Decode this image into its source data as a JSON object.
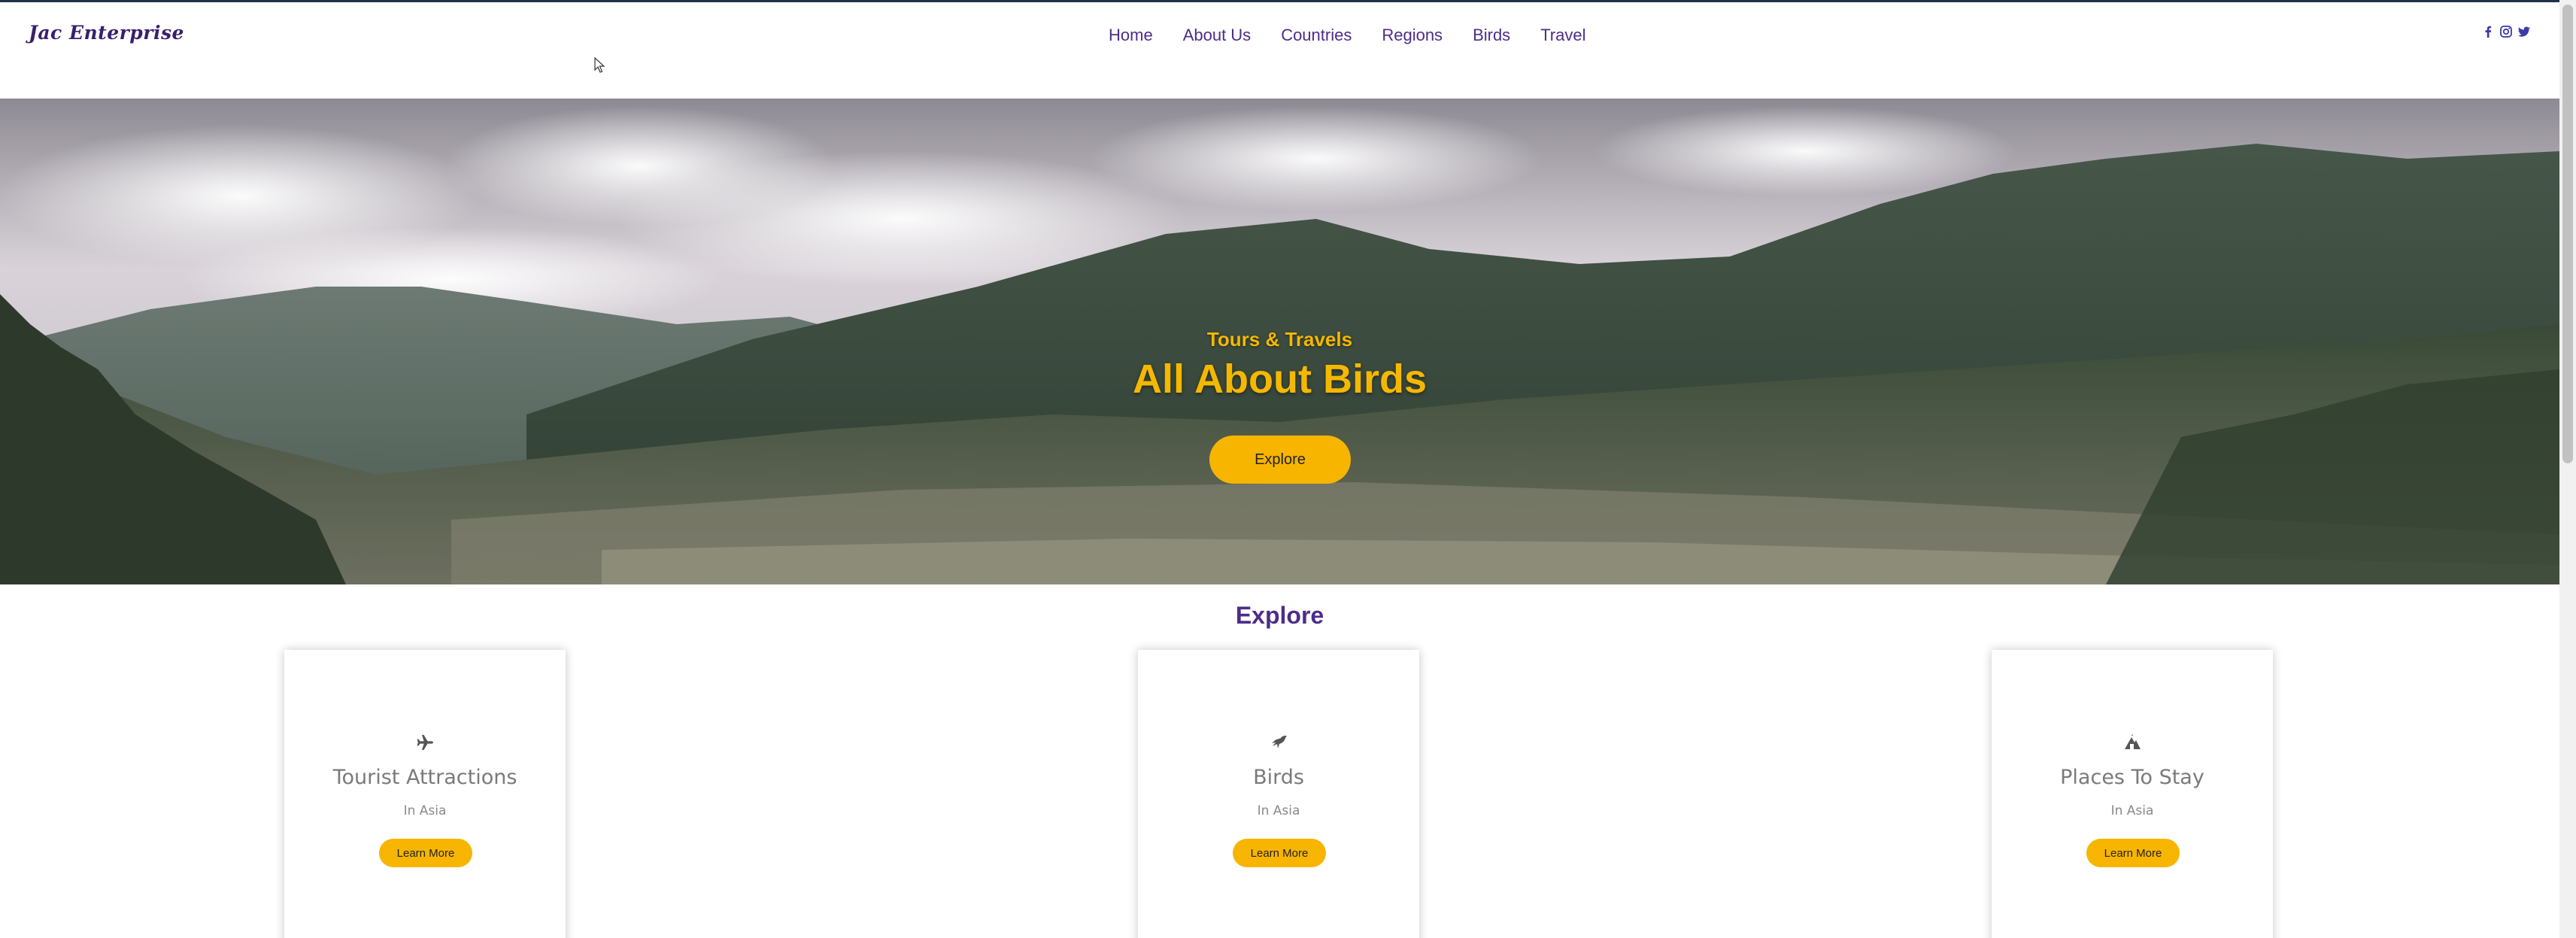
{
  "brand": "Jac Enterprise",
  "nav": {
    "links": [
      "Home",
      "About Us",
      "Countries",
      "Regions",
      "Birds",
      "Travel"
    ]
  },
  "social": [
    "facebook-icon",
    "instagram-icon",
    "twitter-icon"
  ],
  "colors": {
    "brand_purple": "#3a1f6b",
    "nav_purple": "#4d2c8a",
    "accent_yellow": "#f7b500",
    "card_text": "#7a7a7a"
  },
  "hero": {
    "subtitle": "Tours & Travels",
    "title": "All About Birds",
    "button": "Explore"
  },
  "explore": {
    "heading": "Explore",
    "cards": [
      {
        "icon": "plane-icon",
        "title": "Tourist Attractions",
        "subtitle": "In Asia",
        "button": "Learn More"
      },
      {
        "icon": "bird-icon",
        "title": "Birds",
        "subtitle": "In Asia",
        "button": "Learn More"
      },
      {
        "icon": "hotel-icon",
        "title": "Places To Stay",
        "subtitle": "In Asia",
        "button": "Learn More"
      }
    ]
  }
}
